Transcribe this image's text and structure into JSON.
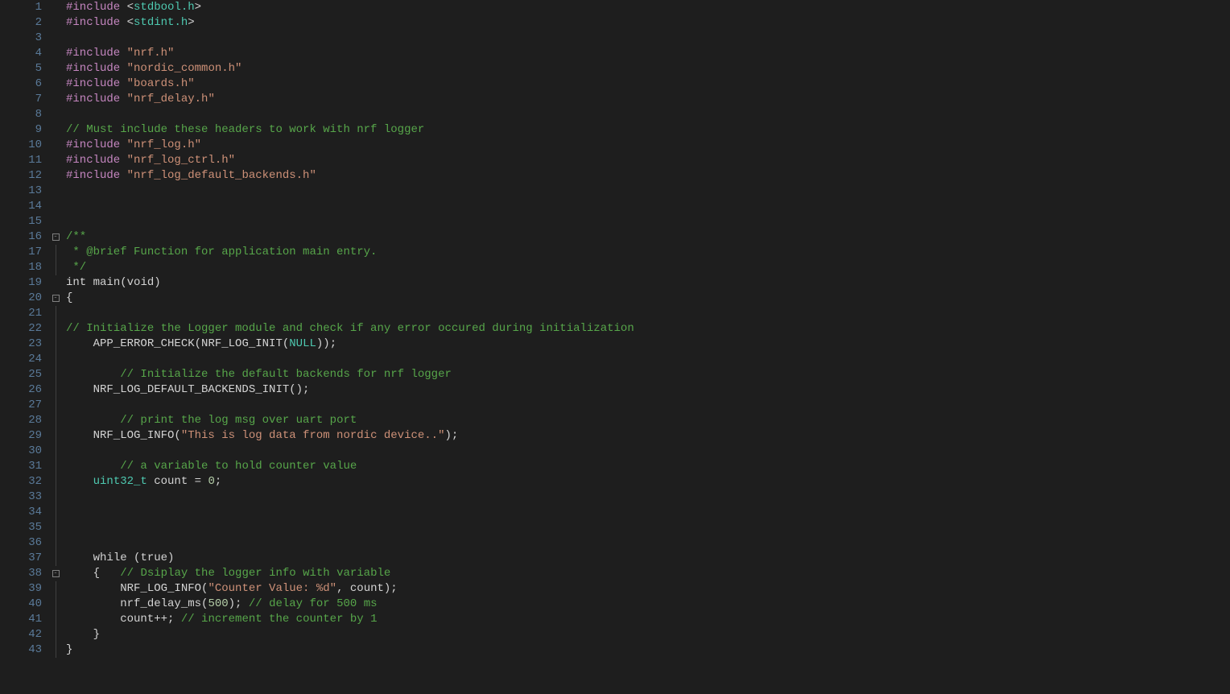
{
  "editor": {
    "language": "c",
    "lineStart": 1,
    "lineEnd": 43,
    "foldPoints": [
      16,
      20,
      38
    ],
    "lines": [
      {
        "n": 1,
        "fold": "",
        "tokens": [
          [
            "pp",
            "#include "
          ],
          [
            "sys",
            "<"
          ],
          [
            "hdr",
            "stdbool.h"
          ],
          [
            "sys",
            ">"
          ]
        ]
      },
      {
        "n": 2,
        "fold": "",
        "tokens": [
          [
            "pp",
            "#include "
          ],
          [
            "sys",
            "<"
          ],
          [
            "hdr",
            "stdint.h"
          ],
          [
            "sys",
            ">"
          ]
        ]
      },
      {
        "n": 3,
        "fold": "",
        "tokens": []
      },
      {
        "n": 4,
        "fold": "",
        "tokens": [
          [
            "pp",
            "#include "
          ],
          [
            "str",
            "\"nrf.h\""
          ]
        ]
      },
      {
        "n": 5,
        "fold": "",
        "tokens": [
          [
            "pp",
            "#include "
          ],
          [
            "str",
            "\"nordic_common.h\""
          ]
        ]
      },
      {
        "n": 6,
        "fold": "",
        "tokens": [
          [
            "pp",
            "#include "
          ],
          [
            "str",
            "\"boards.h\""
          ]
        ]
      },
      {
        "n": 7,
        "fold": "",
        "tokens": [
          [
            "pp",
            "#include "
          ],
          [
            "str",
            "\"nrf_delay.h\""
          ]
        ]
      },
      {
        "n": 8,
        "fold": "",
        "tokens": []
      },
      {
        "n": 9,
        "fold": "",
        "tokens": [
          [
            "cmt",
            "// Must include these headers to work with nrf logger"
          ]
        ]
      },
      {
        "n": 10,
        "fold": "",
        "tokens": [
          [
            "pp",
            "#include "
          ],
          [
            "str",
            "\"nrf_log.h\""
          ]
        ]
      },
      {
        "n": 11,
        "fold": "",
        "tokens": [
          [
            "pp",
            "#include "
          ],
          [
            "str",
            "\"nrf_log_ctrl.h\""
          ]
        ]
      },
      {
        "n": 12,
        "fold": "",
        "tokens": [
          [
            "pp",
            "#include "
          ],
          [
            "str",
            "\"nrf_log_default_backends.h\""
          ]
        ]
      },
      {
        "n": 13,
        "fold": "",
        "tokens": []
      },
      {
        "n": 14,
        "fold": "",
        "tokens": []
      },
      {
        "n": 15,
        "fold": "",
        "tokens": []
      },
      {
        "n": 16,
        "fold": "box",
        "tokens": [
          [
            "doc",
            "/**"
          ]
        ]
      },
      {
        "n": 17,
        "fold": "line",
        "tokens": [
          [
            "doc",
            " * @brief Function for application main entry."
          ]
        ]
      },
      {
        "n": 18,
        "fold": "line",
        "tokens": [
          [
            "doc",
            " */"
          ]
        ]
      },
      {
        "n": 19,
        "fold": "",
        "tokens": [
          [
            "kw",
            "int"
          ],
          [
            "id",
            " "
          ],
          [
            "id",
            "main"
          ],
          [
            "punct",
            "("
          ],
          [
            "kw",
            "void"
          ],
          [
            "punct",
            ")"
          ]
        ]
      },
      {
        "n": 20,
        "fold": "box",
        "tokens": [
          [
            "punct",
            "{"
          ]
        ]
      },
      {
        "n": 21,
        "fold": "line",
        "tokens": []
      },
      {
        "n": 22,
        "fold": "line",
        "tokens": [
          [
            "cmt",
            "// Initialize the Logger module and check if any error occured during initialization"
          ]
        ]
      },
      {
        "n": 23,
        "fold": "line",
        "tokens": [
          [
            "id",
            "    APP_ERROR_CHECK"
          ],
          [
            "punct",
            "("
          ],
          [
            "id",
            "NRF_LOG_INIT"
          ],
          [
            "punct",
            "("
          ],
          [
            "type",
            "NULL"
          ],
          [
            "punct",
            "));"
          ]
        ]
      },
      {
        "n": 24,
        "fold": "line",
        "tokens": []
      },
      {
        "n": 25,
        "fold": "line",
        "tokens": [
          [
            "id",
            "        "
          ],
          [
            "cmt",
            "// Initialize the default backends for nrf logger"
          ]
        ]
      },
      {
        "n": 26,
        "fold": "line",
        "tokens": [
          [
            "id",
            "    NRF_LOG_DEFAULT_BACKENDS_INIT"
          ],
          [
            "punct",
            "();"
          ]
        ]
      },
      {
        "n": 27,
        "fold": "line",
        "tokens": []
      },
      {
        "n": 28,
        "fold": "line",
        "tokens": [
          [
            "id",
            "        "
          ],
          [
            "cmt",
            "// print the log msg over uart port"
          ]
        ]
      },
      {
        "n": 29,
        "fold": "line",
        "tokens": [
          [
            "id",
            "    NRF_LOG_INFO"
          ],
          [
            "punct",
            "("
          ],
          [
            "str",
            "\"This is log data from nordic device..\""
          ],
          [
            "punct",
            ");"
          ]
        ]
      },
      {
        "n": 30,
        "fold": "line",
        "tokens": []
      },
      {
        "n": 31,
        "fold": "line",
        "tokens": [
          [
            "id",
            "        "
          ],
          [
            "cmt",
            "// a variable to hold counter value"
          ]
        ]
      },
      {
        "n": 32,
        "fold": "line",
        "tokens": [
          [
            "id",
            "    "
          ],
          [
            "type",
            "uint32_t"
          ],
          [
            "id",
            " count "
          ],
          [
            "op",
            "="
          ],
          [
            "id",
            " "
          ],
          [
            "num",
            "0"
          ],
          [
            "punct",
            ";"
          ]
        ]
      },
      {
        "n": 33,
        "fold": "line",
        "tokens": []
      },
      {
        "n": 34,
        "fold": "line",
        "tokens": []
      },
      {
        "n": 35,
        "fold": "line",
        "tokens": []
      },
      {
        "n": 36,
        "fold": "line",
        "tokens": []
      },
      {
        "n": 37,
        "fold": "line",
        "tokens": [
          [
            "id",
            "    "
          ],
          [
            "kw",
            "while"
          ],
          [
            "id",
            " "
          ],
          [
            "punct",
            "("
          ],
          [
            "kw",
            "true"
          ],
          [
            "punct",
            ")"
          ]
        ]
      },
      {
        "n": 38,
        "fold": "box",
        "tokens": [
          [
            "id",
            "    "
          ],
          [
            "punct",
            "{"
          ],
          [
            "id",
            "   "
          ],
          [
            "cmt",
            "// Dsiplay the logger info with variable"
          ]
        ]
      },
      {
        "n": 39,
        "fold": "line",
        "tokens": [
          [
            "id",
            "        NRF_LOG_INFO"
          ],
          [
            "punct",
            "("
          ],
          [
            "str",
            "\"Counter Value: %d\""
          ],
          [
            "punct",
            ", "
          ],
          [
            "id",
            "count"
          ],
          [
            "punct",
            ");"
          ]
        ]
      },
      {
        "n": 40,
        "fold": "line",
        "tokens": [
          [
            "id",
            "        nrf_delay_ms"
          ],
          [
            "punct",
            "("
          ],
          [
            "num",
            "500"
          ],
          [
            "punct",
            "); "
          ],
          [
            "cmt",
            "// delay for 500 ms"
          ]
        ]
      },
      {
        "n": 41,
        "fold": "line",
        "tokens": [
          [
            "id",
            "        count"
          ],
          [
            "op",
            "++"
          ],
          [
            "punct",
            "; "
          ],
          [
            "cmt",
            "// increment the counter by 1"
          ]
        ]
      },
      {
        "n": 42,
        "fold": "line",
        "tokens": [
          [
            "id",
            "    "
          ],
          [
            "punct",
            "}"
          ]
        ]
      },
      {
        "n": 43,
        "fold": "line",
        "tokens": [
          [
            "punct",
            "}"
          ]
        ]
      }
    ]
  }
}
